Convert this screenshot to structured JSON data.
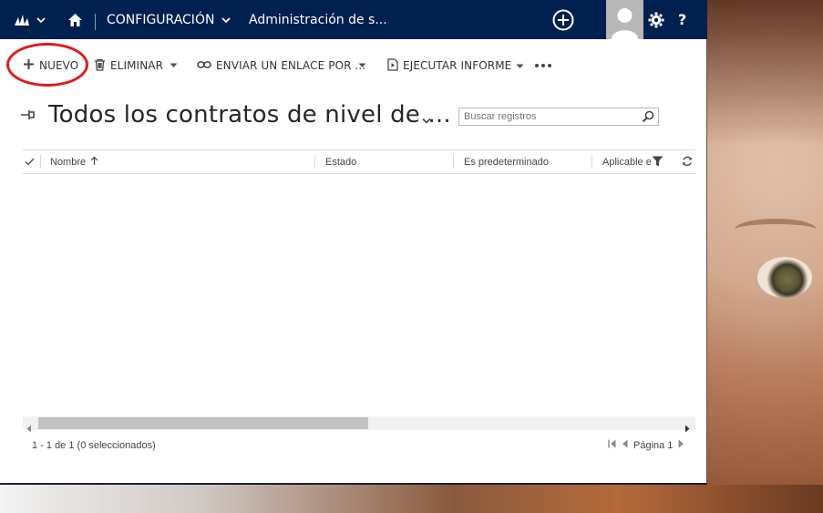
{
  "navbar": {
    "area_label": "CONFIGURACIÓN",
    "page_label": "Administración de s...",
    "help_label": "?"
  },
  "commands": {
    "new_label": "NUEVO",
    "delete_label": "ELIMINAR",
    "email_label": "ENVIAR UN ENLACE POR ...",
    "report_label": "EJECUTAR INFORME"
  },
  "view": {
    "title": "Todos los contratos de nivel de ...",
    "search_placeholder": "Buscar registros"
  },
  "grid": {
    "columns": {
      "nombre": "Nombre",
      "estado": "Estado",
      "default": "Es predeterminado",
      "aplicable": "Aplicable e"
    },
    "sort": "ascending"
  },
  "footer": {
    "status": "1 - 1  de 1 (0 seleccionados)",
    "page_label": "Página 1"
  },
  "colors": {
    "navbar": "#002050",
    "highlight": "#e01a1a"
  },
  "scroll_fraction_visible": 0.49
}
